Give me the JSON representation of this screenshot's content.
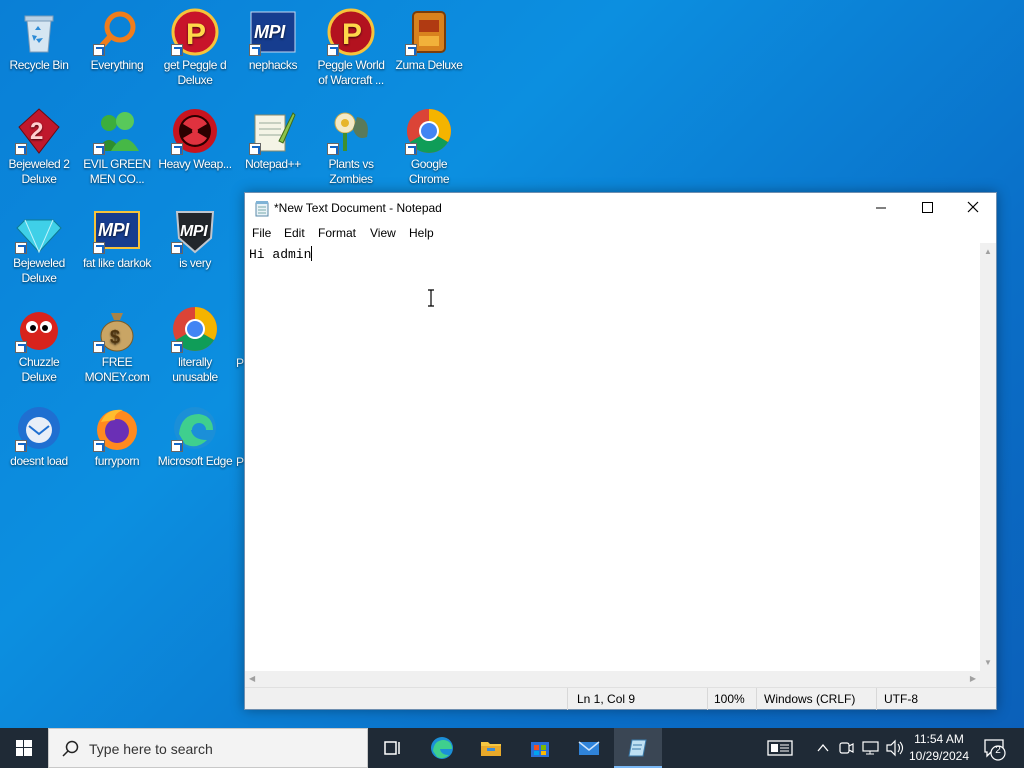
{
  "desktop": {
    "icons": [
      {
        "label": "Recycle Bin"
      },
      {
        "label": "Everything"
      },
      {
        "label": "get Peggle d Deluxe"
      },
      {
        "label": "nephacks"
      },
      {
        "label": "Peggle World of Warcraft ..."
      },
      {
        "label": "Zuma Deluxe"
      },
      {
        "label": "Bejeweled 2 Deluxe"
      },
      {
        "label": "EVIL GREEN MEN CO..."
      },
      {
        "label": "Heavy Weap..."
      },
      {
        "label": "Notepad++"
      },
      {
        "label": "Plants vs Zombies"
      },
      {
        "label": "Google Chrome"
      },
      {
        "label": "Bejeweled Deluxe"
      },
      {
        "label": "fat like darkok"
      },
      {
        "label": "is very"
      },
      {
        "label": "Chuzzle Deluxe"
      },
      {
        "label": "FREE MONEY.com"
      },
      {
        "label": "literally unusable"
      },
      {
        "label": "doesnt load"
      },
      {
        "label": "furryporn"
      },
      {
        "label": "Microsoft Edge"
      }
    ],
    "partial_labels": [
      "P",
      "P"
    ]
  },
  "notepad": {
    "title": "*New Text Document - Notepad",
    "menu": [
      "File",
      "Edit",
      "Format",
      "View",
      "Help"
    ],
    "content": "Hi admin",
    "status": {
      "position": "Ln 1, Col 9",
      "zoom": "100%",
      "line_endings": "Windows (CRLF)",
      "encoding": "UTF-8"
    }
  },
  "taskbar": {
    "search_placeholder": "Type here to search",
    "apps": [
      "task-view-icon",
      "edge-icon",
      "file-explorer-icon",
      "store-icon",
      "mail-icon",
      "notepad-icon"
    ],
    "clock_time": "11:54 AM",
    "clock_date": "10/29/2024",
    "notification_count": "2"
  },
  "colors": {
    "desktop_accent": "#0a7fd6",
    "taskbar": "#1f2a36",
    "active_indicator": "#7ab8f5"
  }
}
